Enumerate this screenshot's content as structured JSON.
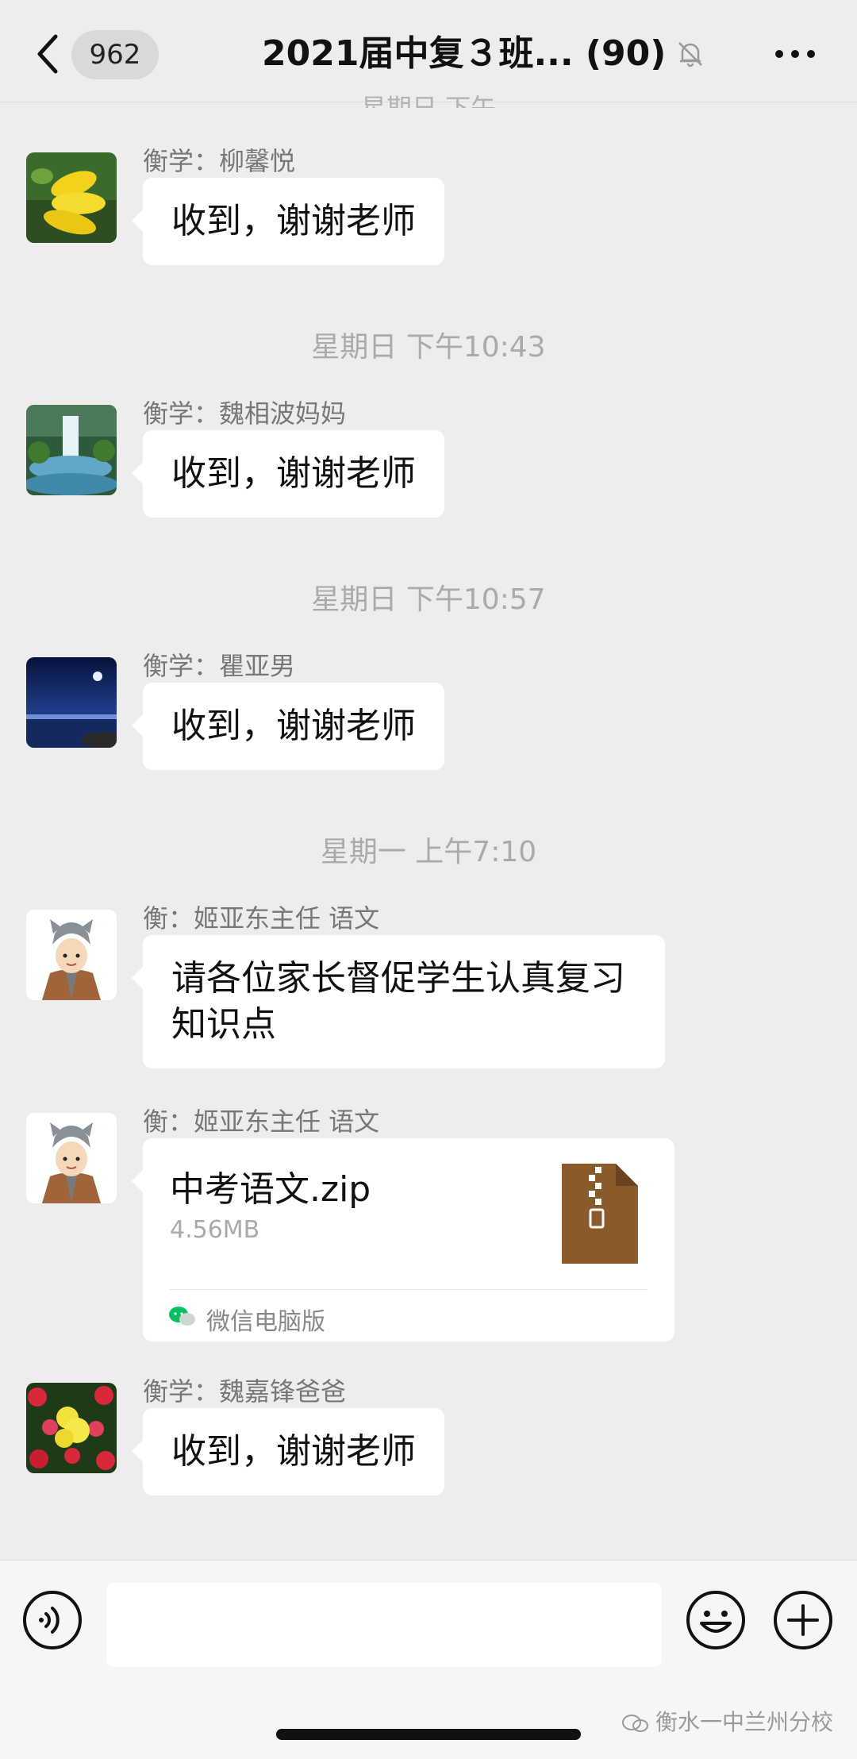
{
  "header": {
    "unread_count": "962",
    "title": "2021届中复３班... (90)"
  },
  "chat": {
    "clipped_timestamp": "星期日 下午",
    "messages": [
      {
        "type": "text",
        "sender": "衡学：柳馨悦",
        "text": "收到，谢谢老师",
        "avatar": "yellow-flower-avatar"
      },
      {
        "type": "timestamp",
        "text": "星期日 下午10:43"
      },
      {
        "type": "text",
        "sender": "衡学：魏相波妈妈",
        "text": "收到，谢谢老师",
        "avatar": "waterfall-avatar"
      },
      {
        "type": "timestamp",
        "text": "星期日 下午10:57"
      },
      {
        "type": "text",
        "sender": "衡学：瞿亚男",
        "text": "收到，谢谢老师",
        "avatar": "night-sea-avatar"
      },
      {
        "type": "timestamp",
        "text": "星期一 上午7:10"
      },
      {
        "type": "text",
        "sender": "衡：姬亚东主任  语文",
        "text": "请各位家长督促学生认真复习知识点",
        "avatar": "cartoon-cat-hat-avatar"
      },
      {
        "type": "file",
        "sender": "衡：姬亚东主任  语文",
        "file_name": "中考语文.zip",
        "file_size": "4.56MB",
        "source": "微信电脑版",
        "avatar": "cartoon-cat-hat-avatar"
      },
      {
        "type": "text",
        "sender": "衡学：魏嘉锋爸爸",
        "text": "收到，谢谢老师",
        "avatar": "red-yellow-flowers-avatar"
      }
    ]
  },
  "input_bar": {
    "value": "",
    "placeholder": ""
  },
  "watermark": "衡水一中兰州分校",
  "colors": {
    "background": "#ededed",
    "bubble": "#ffffff",
    "zip_file_brown": "#8b5a2b",
    "wechat_green": "#07c160"
  }
}
